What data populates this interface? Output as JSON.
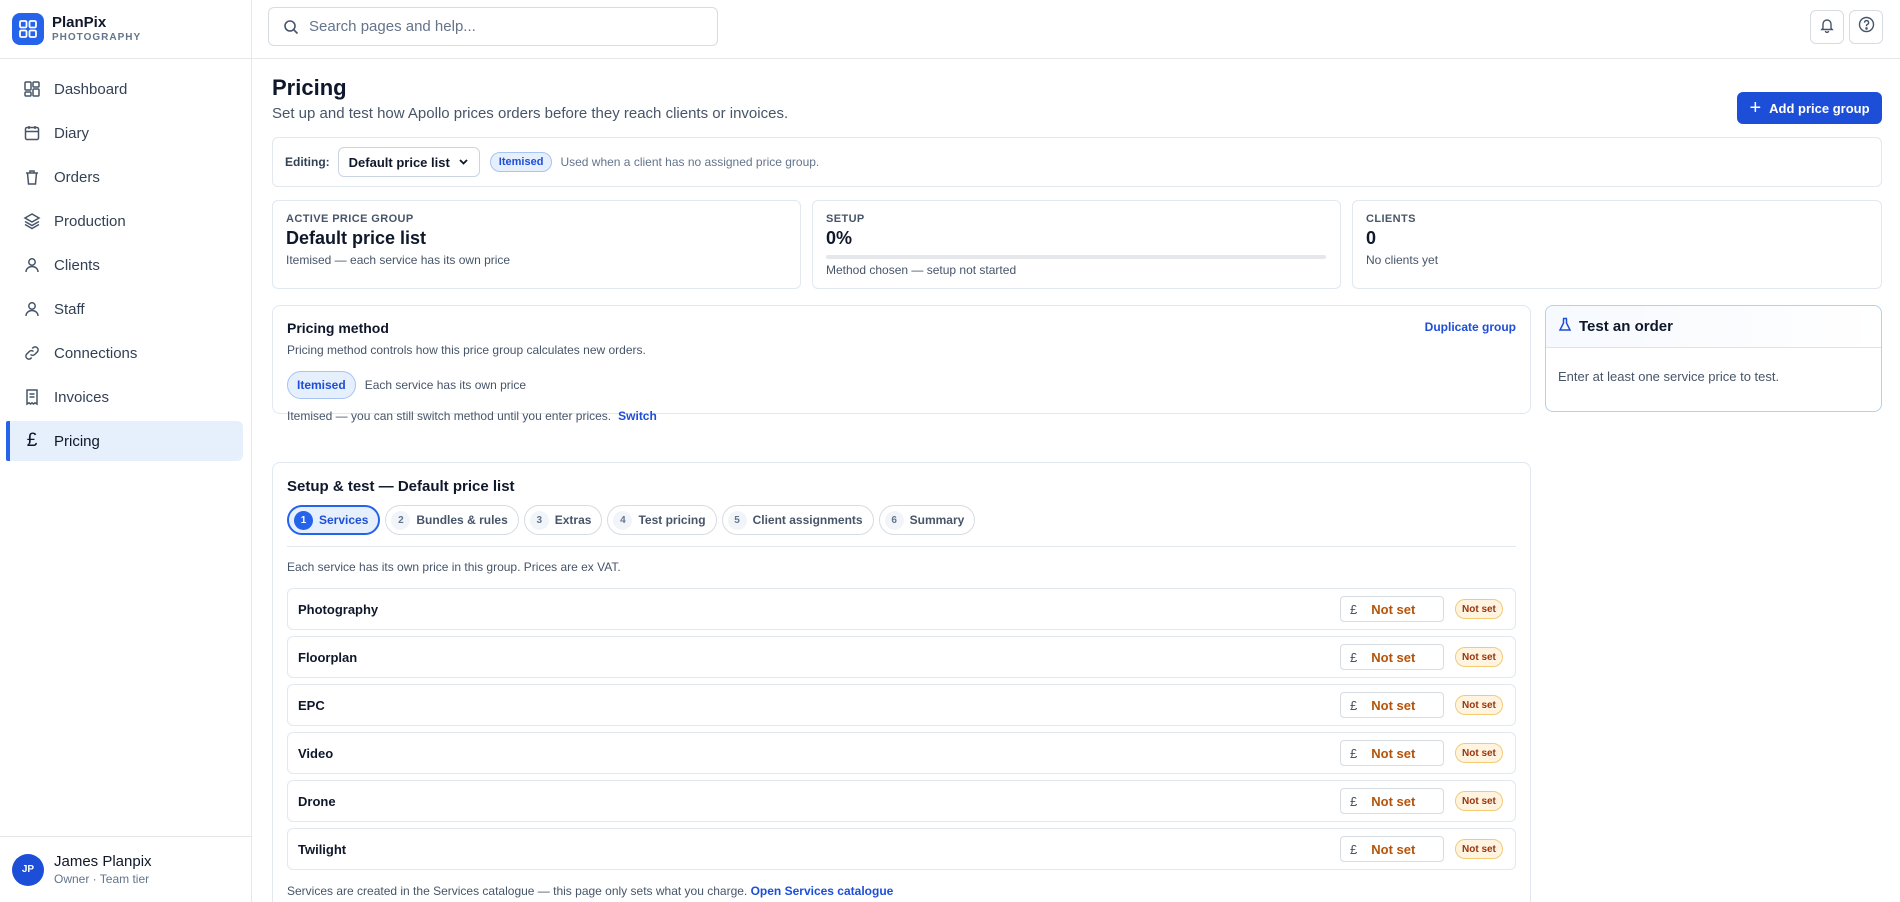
{
  "brand": {
    "name": "PlanPix",
    "tagline": "PHOTOGRAPHY"
  },
  "sidebar": {
    "items": [
      {
        "label": "Dashboard",
        "icon": "grid-icon"
      },
      {
        "label": "Diary",
        "icon": "calendar-icon"
      },
      {
        "label": "Orders",
        "icon": "trash-icon"
      },
      {
        "label": "Production",
        "icon": "layers-icon"
      },
      {
        "label": "Clients",
        "icon": "user-icon"
      },
      {
        "label": "Staff",
        "icon": "user-icon"
      },
      {
        "label": "Connections",
        "icon": "link-icon"
      },
      {
        "label": "Invoices",
        "icon": "receipt-icon"
      },
      {
        "label": "Pricing",
        "icon": "pound-icon",
        "active": true
      }
    ]
  },
  "user": {
    "initials": "JP",
    "name": "James Planpix",
    "role": "Owner · Team tier"
  },
  "topbar": {
    "search_placeholder": "Search pages and help..."
  },
  "header": {
    "title": "Pricing",
    "subtitle": "Set up and test how Apollo prices orders before they reach clients or invoices.",
    "add_button": "Add price group"
  },
  "editing": {
    "label": "Editing:",
    "selected": "Default price list",
    "badge": "Itemised",
    "note": "Used when a client has no assigned price group."
  },
  "stats": {
    "active": {
      "label": "ACTIVE PRICE GROUP",
      "value": "Default price list",
      "desc": "Itemised — each service has its own price"
    },
    "setup": {
      "label": "SETUP",
      "value": "0%",
      "progress": 0,
      "desc": "Method chosen — setup not started"
    },
    "clients": {
      "label": "CLIENTS",
      "value": "0",
      "desc": "No clients yet"
    }
  },
  "pricing_method": {
    "title": "Pricing method",
    "duplicate": "Duplicate group",
    "desc": "Pricing method controls how this price group calculates new orders.",
    "pill": "Itemised",
    "pill_desc": "Each service has its own price",
    "footer": "Itemised — you can still switch method until you enter prices.",
    "switch": "Switch"
  },
  "test_order": {
    "title": "Test an order",
    "body": "Enter at least one service price to test."
  },
  "setup": {
    "title": "Setup & test — Default price list",
    "steps": [
      {
        "num": "1",
        "label": "Services",
        "active": true
      },
      {
        "num": "2",
        "label": "Bundles & rules"
      },
      {
        "num": "3",
        "label": "Extras"
      },
      {
        "num": "4",
        "label": "Test pricing"
      },
      {
        "num": "5",
        "label": "Client assignments"
      },
      {
        "num": "6",
        "label": "Summary"
      }
    ],
    "note": "Each service has its own price in this group. Prices are ex VAT.",
    "currency": "£",
    "price_placeholder": "Not set",
    "status_badge": "Not set",
    "services": [
      "Photography",
      "Floorplan",
      "EPC",
      "Video",
      "Drone",
      "Twilight"
    ],
    "footer": "Services are created in the Services catalogue — this page only sets what you charge.",
    "footer_link": "Open Services catalogue"
  },
  "colors": {
    "accent": "#2563eb",
    "accent_dark": "#1d4ed8",
    "warning": "#b45309"
  }
}
